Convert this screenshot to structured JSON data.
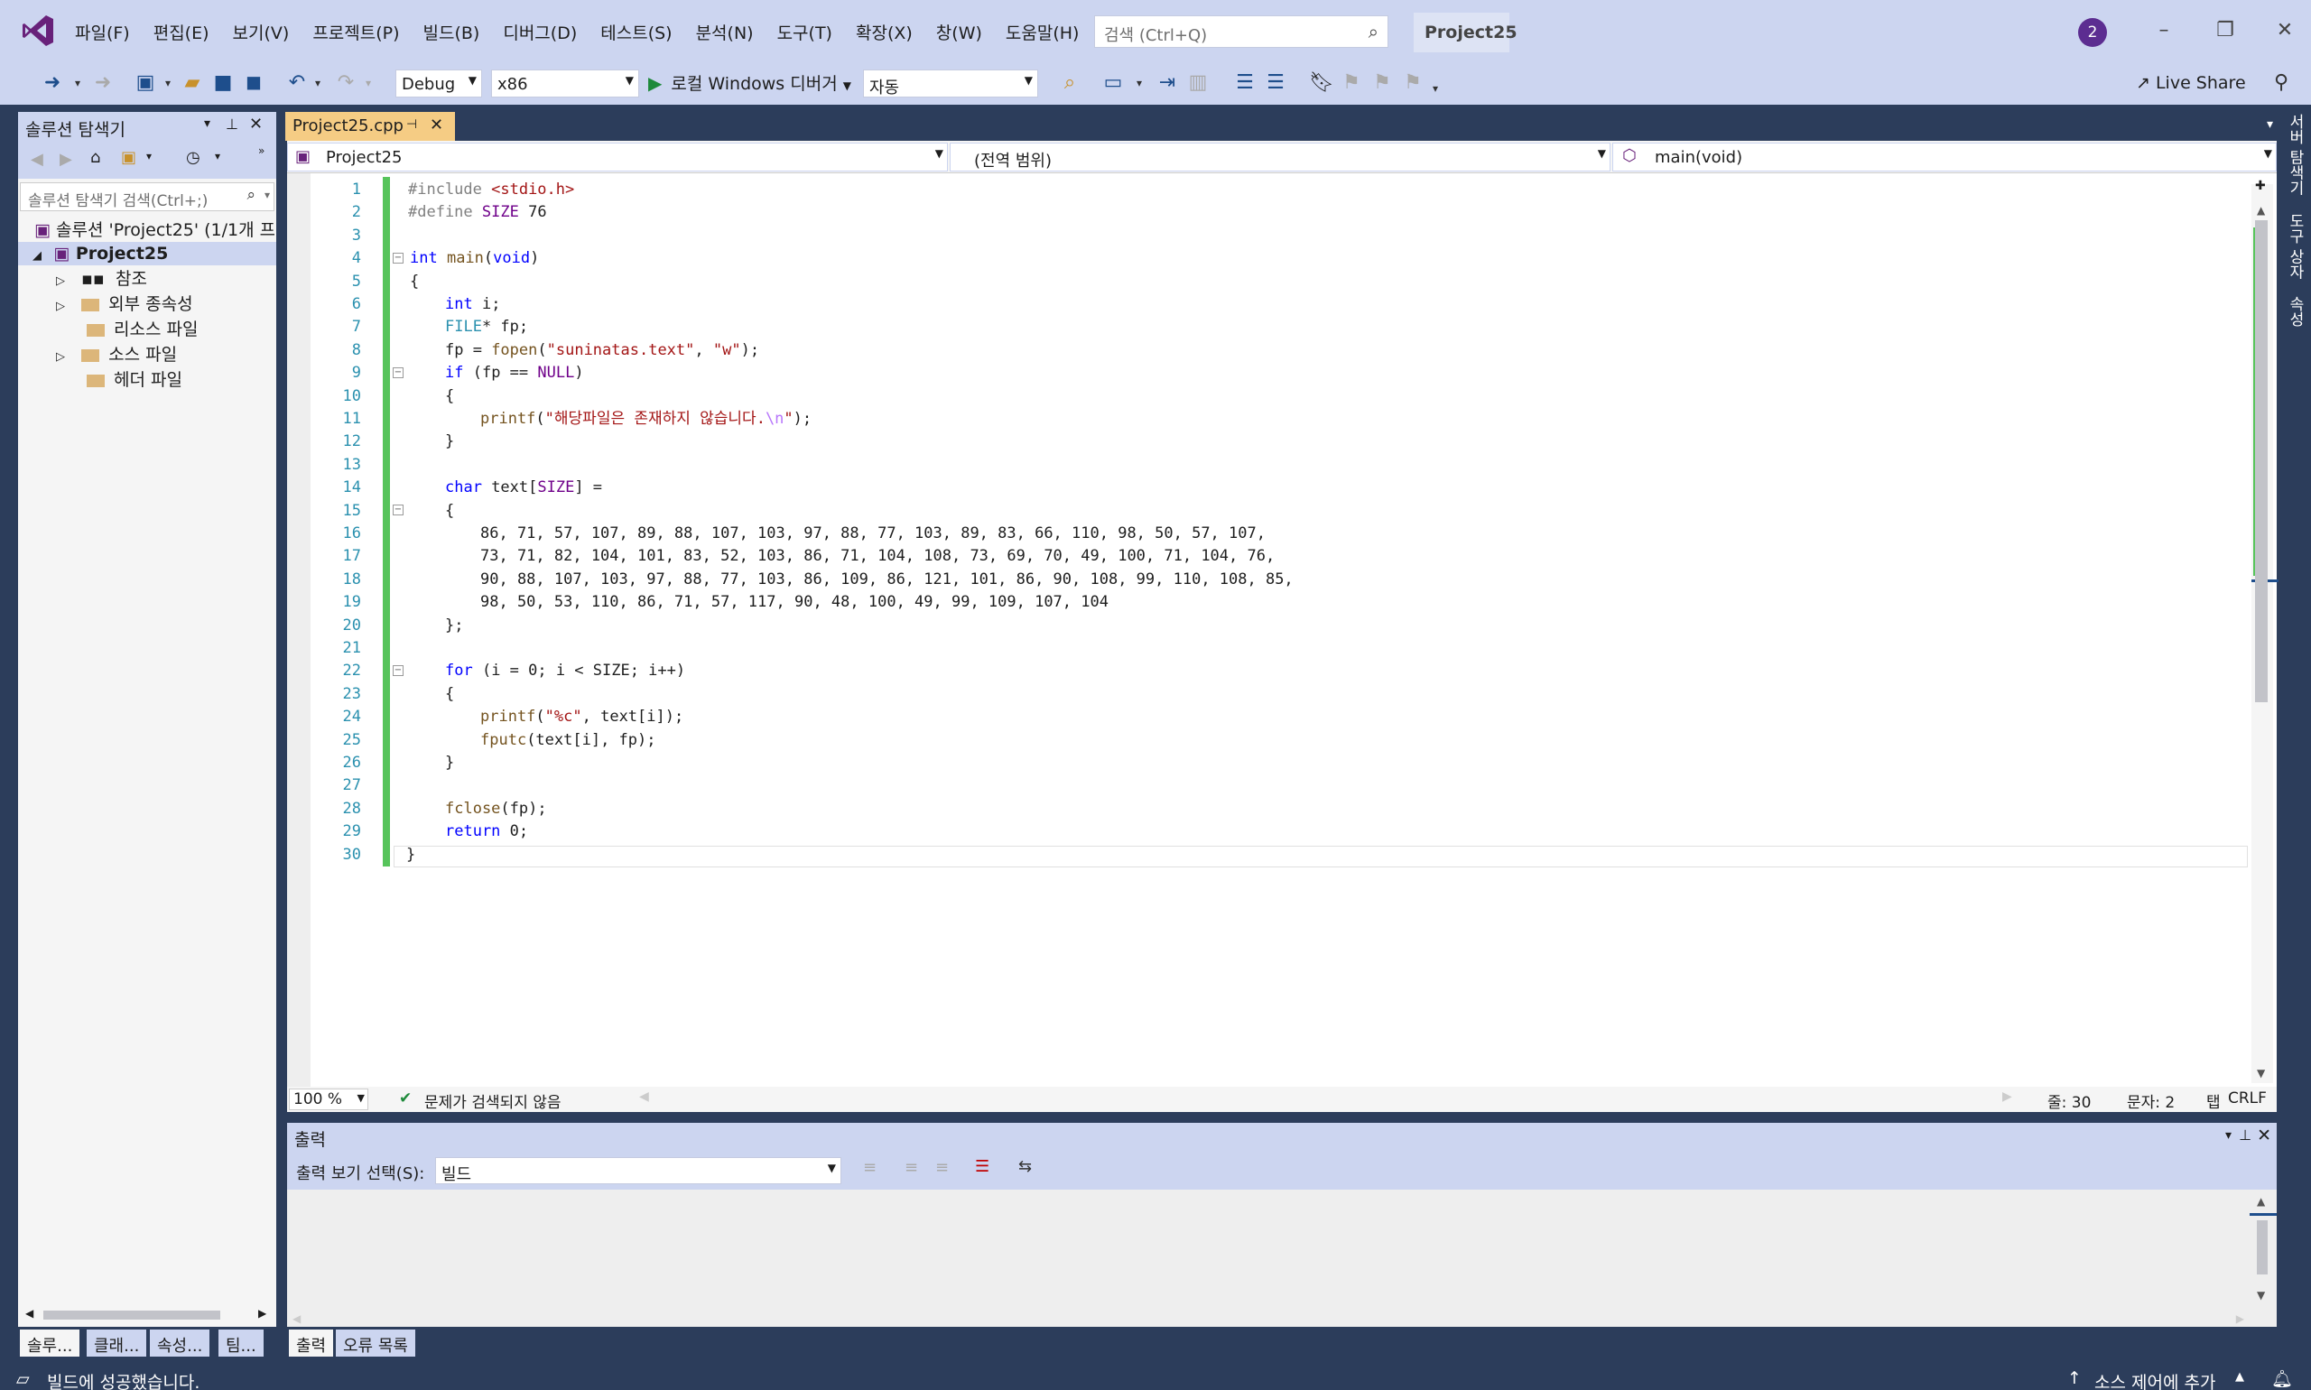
{
  "menu": [
    "파일(F)",
    "편집(E)",
    "보기(V)",
    "프로젝트(P)",
    "빌드(B)",
    "디버그(D)",
    "테스트(S)",
    "분석(N)",
    "도구(T)",
    "확장(X)",
    "창(W)",
    "도움말(H)"
  ],
  "search": {
    "placeholder": "검색 (Ctrl+Q)"
  },
  "project_title": "Project25",
  "notifications": "2",
  "toolbar": {
    "config": "Debug",
    "platform": "x86",
    "run_label": "로컬 Windows 디버거",
    "mode": "자동",
    "live_share": "Live Share"
  },
  "solution_explorer": {
    "title": "솔루션 탐색기",
    "search_placeholder": "솔루션 탐색기 검색(Ctrl+;)",
    "solution_label": "솔루션 'Project25' (1/1개 프로",
    "project": "Project25",
    "items": [
      "참조",
      "외부 종속성",
      "리소스 파일",
      "소스 파일",
      "헤더 파일"
    ]
  },
  "left_tabs": [
    "솔루...",
    "클래...",
    "속성...",
    "팀..."
  ],
  "editor": {
    "file_tab": "Project25.cpp",
    "nav_project": "Project25",
    "nav_scope": "(전역 범위)",
    "nav_member": "main(void)",
    "line_numbers": [
      "1",
      "2",
      "3",
      "4",
      "5",
      "6",
      "7",
      "8",
      "9",
      "10",
      "11",
      "12",
      "13",
      "14",
      "15",
      "16",
      "17",
      "18",
      "19",
      "20",
      "21",
      "22",
      "23",
      "24",
      "25",
      "26",
      "27",
      "28",
      "29",
      "30"
    ]
  },
  "code": {
    "l1a": "#include ",
    "l1b": "<stdio.h>",
    "l2a": "#define ",
    "l2b": "SIZE",
    " l2c": " 76",
    "l4a": "int ",
    "l4b": "main",
    "l4c": "(",
    "l4d": "void",
    "l4e": ")",
    "l5": "{",
    "l6a": "int ",
    "l6b": "i;",
    "l7a": "FILE",
    "l7b": "* fp;",
    "l8a": "fp = ",
    "l8b": "fopen",
    "l8c": "(",
    "l8d": "\"suninatas.text\"",
    "l8e": ", ",
    "l8f": "\"w\"",
    "l8g": ");",
    "l9a": "if ",
    "l9b": "(fp == ",
    "l9c": "NULL",
    "l9d": ")",
    "l10": "{",
    "l11a": "printf",
    "l11b": "(",
    "l11c": "\"해당파일은 존재하지 않습니다.",
    "l11d": "\\n",
    "l11e": "\"",
    "l11f": ");",
    "l12": "}",
    "l14a": "char ",
    "l14b": "text[",
    "l14c": "SIZE",
    "l14d": "] =",
    "l15": "{",
    "l16": "86, 71, 57, 107, 89, 88, 107, 103, 97, 88, 77, 103, 89, 83, 66, 110, 98, 50, 57, 107,",
    "l17": "73, 71, 82, 104, 101, 83, 52, 103, 86, 71, 104, 108, 73, 69, 70, 49, 100, 71, 104, 76,",
    "l18": "90, 88, 107, 103, 97, 88, 77, 103, 86, 109, 86, 121, 101, 86, 90, 108, 99, 110, 108, 85,",
    "l19": "98, 50, 53, 110, 86, 71, 57, 117, 90, 48, 100, 49, 99, 109, 107, 104",
    "l20": "};",
    "l22a": "for ",
    "l22b": "(i = 0; i < SIZE; i++)",
    "l23": "{",
    "l24a": "printf",
    "l24b": "(",
    "l24c": "\"%c\"",
    "l24d": ", text[i]);",
    "l25a": "fputc",
    "l25b": "(text[i], fp);",
    "l26": "}",
    "l28a": "fclose",
    "l28b": "(fp);",
    "l29a": "return ",
    "l29b": "0;",
    "l30": "}"
  },
  "status": {
    "zoom": "100 %",
    "issues": "문제가 검색되지 않음",
    "line": "줄: 30",
    "col": "문자: 2",
    "tab": "탭",
    "eol": "CRLF"
  },
  "output": {
    "title": "출력",
    "show_label": "출력 보기 선택(S):",
    "source": "빌드"
  },
  "bottom_tabs": [
    "출력",
    "오류 목록"
  ],
  "statusbar": {
    "message": "빌드에 성공했습니다.",
    "source_control": "소스 제어에 추가"
  },
  "right_tools": [
    "서버 탐색기",
    "도구 상자",
    "속성"
  ]
}
